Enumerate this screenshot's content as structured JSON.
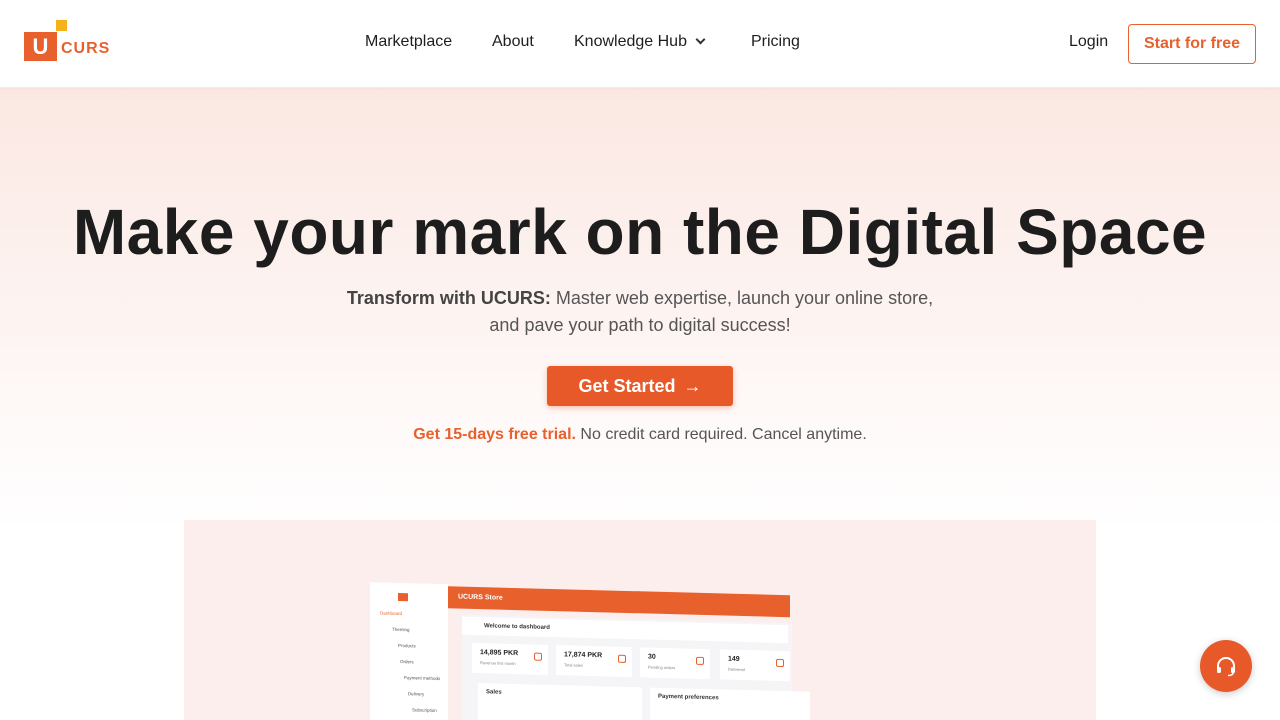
{
  "brand": {
    "logo_letter": "U",
    "logo_text": "CURS",
    "accent": "#e8602c",
    "accent_yellow": "#f6b21a"
  },
  "nav": {
    "items": [
      {
        "label": "Marketplace"
      },
      {
        "label": "About"
      },
      {
        "label": "Knowledge Hub",
        "has_dropdown": true
      },
      {
        "label": "Pricing"
      }
    ],
    "login_label": "Login",
    "start_label": "Start for free"
  },
  "hero": {
    "headline": "Make your mark on the Digital Space",
    "sub_bold": "Transform with UCURS:",
    "sub_text": " Master web expertise, launch your online store, and pave your path to digital success!",
    "cta_label": "Get Started",
    "trial_highlight": "Get 15-days free trial.",
    "trial_text": " No credit card required. Cancel anytime."
  },
  "dashboard_preview": {
    "store_title": "UCURS Store",
    "welcome": "Welcome to dashboard",
    "sidebar": [
      "Dashboard",
      "Theming",
      "Products",
      "Orders",
      "Payment methods",
      "Delivery",
      "Subscription"
    ],
    "cards": [
      {
        "value": "14,895 PKR",
        "label": "Revenue this month"
      },
      {
        "value": "17,874 PKR",
        "label": "Total sales"
      },
      {
        "value": "30",
        "label": "Pending orders"
      },
      {
        "value": "149",
        "label": "Delivered"
      }
    ],
    "panels": [
      "Sales",
      "Payment preferences"
    ]
  },
  "support": {
    "icon": "headset-icon"
  }
}
